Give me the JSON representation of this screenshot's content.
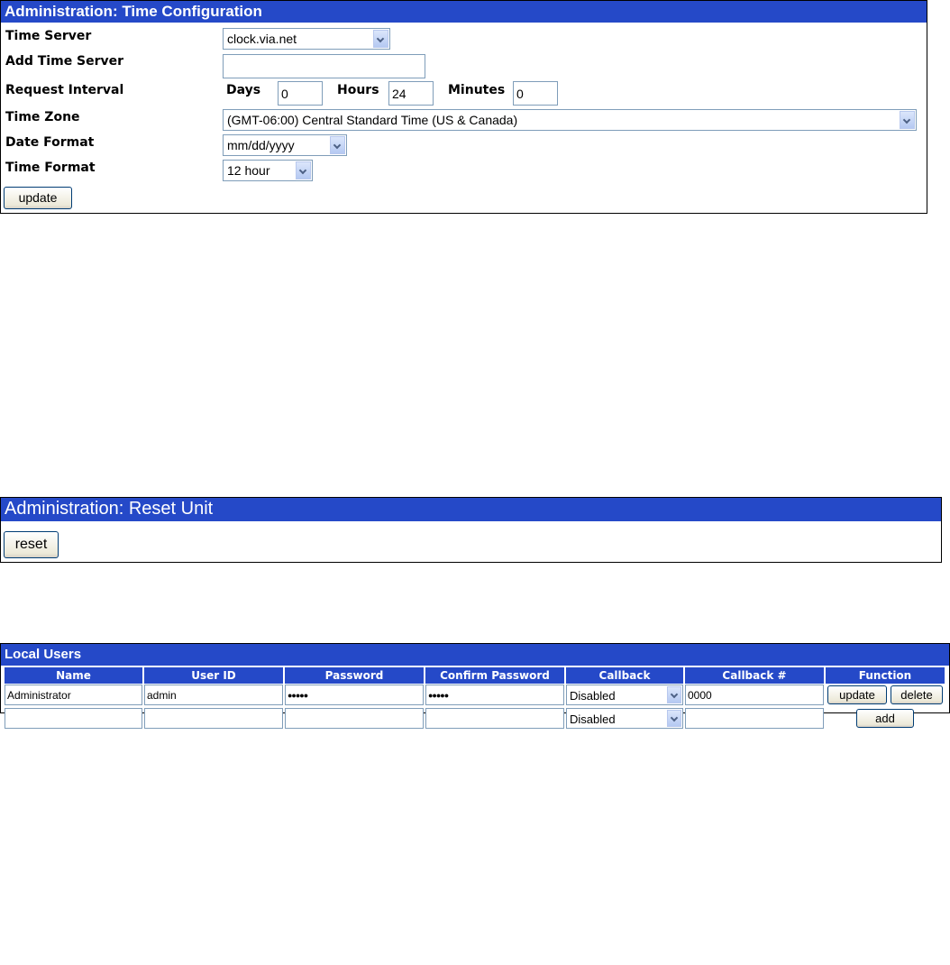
{
  "time_config": {
    "title": "Administration: Time Configuration",
    "time_server_label": "Time Server",
    "time_server_value": "clock.via.net",
    "add_time_server_label": "Add Time Server",
    "add_time_server_value": "",
    "request_interval_label": "Request Interval",
    "days_label": "Days",
    "days_value": "0",
    "hours_label": "Hours",
    "hours_value": "24",
    "minutes_label": "Minutes",
    "minutes_value": "0",
    "time_zone_label": "Time Zone",
    "time_zone_value": "(GMT-06:00) Central Standard Time (US & Canada)",
    "date_format_label": "Date Format",
    "date_format_value": "mm/dd/yyyy",
    "time_format_label": "Time Format",
    "time_format_value": "12 hour",
    "update_label": "update"
  },
  "reset_unit": {
    "title": "Administration: Reset Unit",
    "reset_label": "reset"
  },
  "local_users": {
    "title": "Local Users",
    "columns": [
      "Name",
      "User ID",
      "Password",
      "Confirm Password",
      "Callback",
      "Callback #",
      "Function"
    ],
    "rows": [
      {
        "name": "Administrator",
        "user_id": "admin",
        "password": "●●●●●",
        "confirm": "●●●●●",
        "callback": "Disabled",
        "callback_num": "0000"
      },
      {
        "name": "",
        "user_id": "",
        "password": "",
        "confirm": "",
        "callback": "Disabled",
        "callback_num": ""
      }
    ],
    "update_label": "update",
    "delete_label": "delete",
    "add_label": "add"
  },
  "icons": [
    "chevron-down-icon"
  ]
}
